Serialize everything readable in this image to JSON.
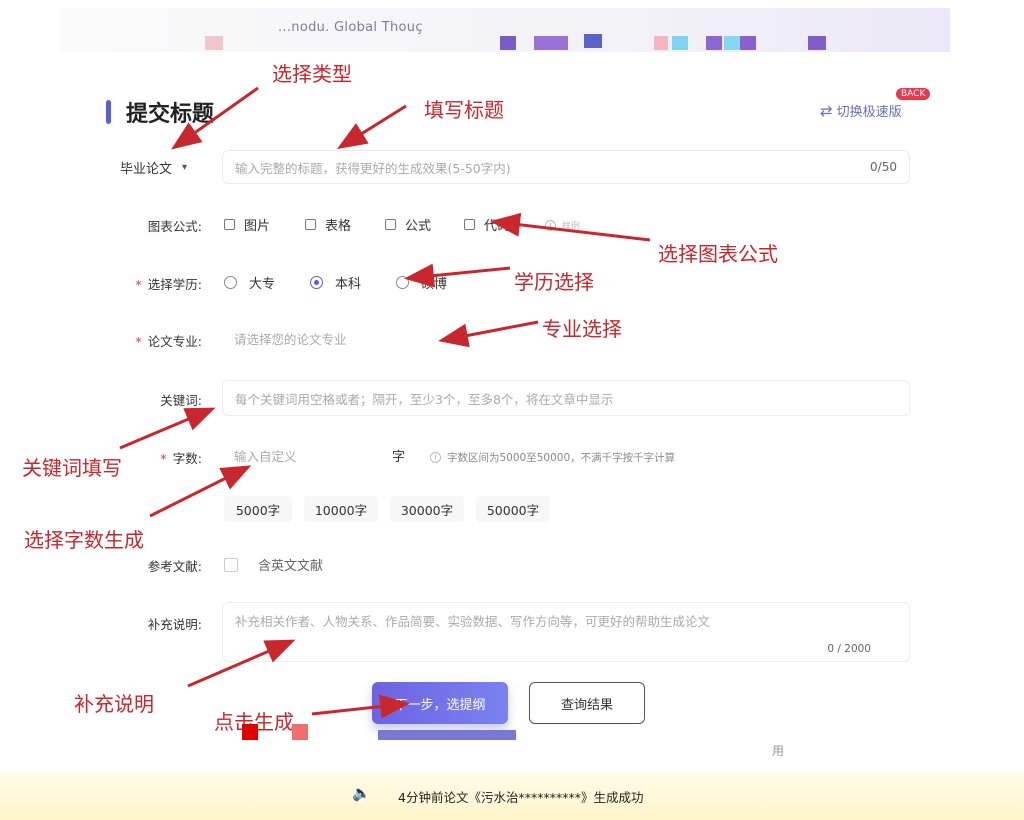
{
  "header": {
    "site_text": "...nodu. Global Thouç"
  },
  "colors": {
    "accent": "#5b5fd6",
    "annotation": "#c7272d",
    "required": "#e03a3a"
  },
  "page": {
    "title": "提交标题",
    "switch_label": "切换极速版",
    "back_badge": "BACK"
  },
  "form": {
    "type_select": {
      "value": "毕业论文",
      "caret": "▾"
    },
    "title_input": {
      "placeholder": "输入完整的标题，获得更好的生成效果(5-50字内)",
      "counter": "0/50"
    },
    "charts": {
      "label": "图表公式:",
      "options": [
        "图片",
        "表格",
        "公式",
        "代码"
      ],
      "extra": "样例"
    },
    "education": {
      "required_mark": "*",
      "label": "选择学历:",
      "options": [
        "大专",
        "本科",
        "硕博"
      ],
      "selected": "本科"
    },
    "major": {
      "required_mark": "*",
      "label": "论文专业:",
      "placeholder": "请选择您的论文专业"
    },
    "keywords": {
      "label": "关键词:",
      "placeholder": "每个关键词用空格或者；隔开，至少3个，至多8个，将在文章中显示"
    },
    "word_count": {
      "required_mark": "*",
      "label": "字数:",
      "placeholder": "输入自定义",
      "unit": "字",
      "hint": "字数区间为5000至50000，不满千字按千字计算",
      "presets": [
        "5000字",
        "10000字",
        "30000字",
        "50000字"
      ]
    },
    "references": {
      "label": "参考文献:",
      "option": "含英文文献"
    },
    "supplement": {
      "label": "补充说明:",
      "placeholder": "补充相关作者、人物关系、作品简要、实验数据、写作方向等，可更好的帮助生成论文",
      "counter": "0 / 2000"
    },
    "buttons": {
      "next": "下一步，选提纲",
      "query": "查询结果"
    },
    "faint_text": "用"
  },
  "footer": {
    "ticker": "4分钟前论文《污水治**********》生成成功"
  },
  "annotations": {
    "select_type": "选择类型",
    "fill_title": "填写标题",
    "select_charts": "选择图表公式",
    "education": "学历选择",
    "major": "专业选择",
    "keywords": "关键词填写",
    "word_count": "选择字数生成",
    "supplement": "补充说明",
    "click_generate": "点击生成"
  }
}
